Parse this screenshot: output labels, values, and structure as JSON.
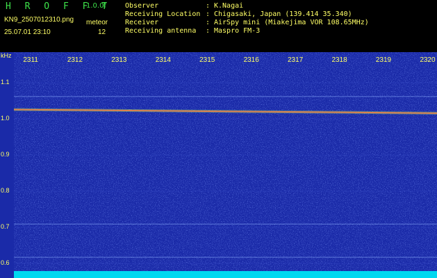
{
  "header": {
    "app_title": "H R O F F T",
    "version": "1.0.0f",
    "filename": "KN9_2507012310.png",
    "datetime": "25.07.01 23:10",
    "mode": "meteor",
    "count": "12"
  },
  "info": [
    {
      "label": "Observer",
      "value": "K.Nagai"
    },
    {
      "label": "Receiving Location",
      "value": "Chigasaki, Japan (139.414 35.340)"
    },
    {
      "label": "Receiver",
      "value": "AirSpy mini (Miakejima VOR 108.65MHz)"
    },
    {
      "label": "Receiving antenna",
      "value": "Maspro FM-3"
    }
  ],
  "info_separator": ":",
  "colors": {
    "label_yellow": "#ffff66",
    "title_green": "#3ee24a",
    "bg_blue": "#1a2aa8",
    "baseline_cyan": "#00d8f0",
    "carrier_red": "#ff4040"
  },
  "chart_data": {
    "type": "heatmap",
    "y_unit": "kHz",
    "y_ticks": [
      "1.1",
      "1.0",
      "0.9",
      "0.8",
      "0.7",
      "0.6"
    ],
    "y_tick_values": [
      1.1,
      1.0,
      0.9,
      0.8,
      0.7,
      0.6
    ],
    "ylim": [
      0.575,
      1.185
    ],
    "x_ticks": [
      "2311",
      "2312",
      "2313",
      "2314",
      "2315",
      "2316",
      "2317",
      "2318",
      "2319",
      "2320"
    ],
    "xlim": [
      2310.6,
      2320.2
    ],
    "carrier_line": {
      "x": [
        2310.6,
        2320.2
      ],
      "y": [
        1.026,
        1.016
      ]
    },
    "faint_lines_khz": [
      1.062,
      0.709,
      0.617
    ]
  }
}
